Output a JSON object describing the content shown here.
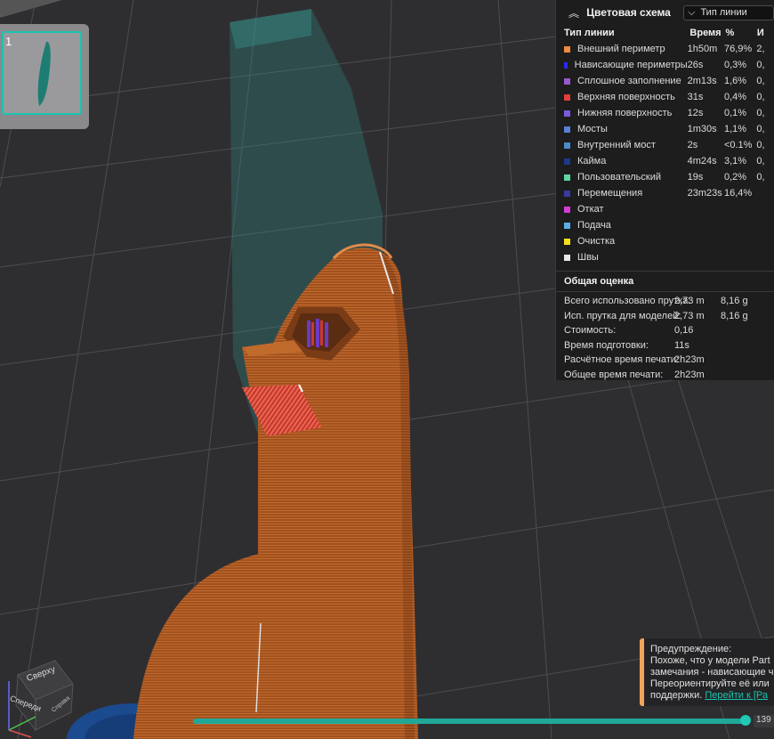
{
  "plate": {
    "number": "1",
    "arrow": ">"
  },
  "legend": {
    "collapse_icon": "double-chevron-up",
    "title": "Цветовая схема",
    "select_value": "Тип линии",
    "columns": [
      "Тип линии",
      "Время",
      "%",
      "И"
    ],
    "rows": [
      {
        "name": "Внешний периметр",
        "time": "1h50m",
        "pct": "76,9%",
        "extra": "2,",
        "color": "#f08a3c"
      },
      {
        "name": "Нависающие периметры",
        "time": "26s",
        "pct": "0,3%",
        "extra": "0,",
        "color": "#2a2aff"
      },
      {
        "name": "Сплошное заполнение",
        "time": "2m13s",
        "pct": "1,6%",
        "extra": "0,",
        "color": "#9b59d0"
      },
      {
        "name": "Верхняя поверхность",
        "time": "31s",
        "pct": "0,4%",
        "extra": "0,",
        "color": "#e0403a"
      },
      {
        "name": "Нижняя поверхность",
        "time": "12s",
        "pct": "0,1%",
        "extra": "0,",
        "color": "#7a5be0"
      },
      {
        "name": "Мосты",
        "time": "1m30s",
        "pct": "1,1%",
        "extra": "0,",
        "color": "#5a7fd6"
      },
      {
        "name": "Внутренний мост",
        "time": "2s",
        "pct": "<0.1%",
        "extra": "0,",
        "color": "#4a8cc8"
      },
      {
        "name": "Кайма",
        "time": "4m24s",
        "pct": "3,1%",
        "extra": "0,",
        "color": "#1a3a8a"
      },
      {
        "name": "Пользовательский",
        "time": "19s",
        "pct": "0,2%",
        "extra": "0,",
        "color": "#5ed6a0"
      },
      {
        "name": "Перемещения",
        "time": "23m23s",
        "pct": "16,4%",
        "extra": "",
        "color": "#3a3aa0"
      },
      {
        "name": "Откат",
        "time": "",
        "pct": "",
        "extra": "",
        "color": "#d63ad6"
      },
      {
        "name": "Подача",
        "time": "",
        "pct": "",
        "extra": "",
        "color": "#5aaee8"
      },
      {
        "name": "Очистка",
        "time": "",
        "pct": "",
        "extra": "",
        "color": "#f5e11a"
      },
      {
        "name": "Швы",
        "time": "",
        "pct": "",
        "extra": "",
        "color": "#e8e8e8"
      }
    ],
    "summary_title": "Общая оценка",
    "summary": [
      {
        "k": "Всего использовано прутка:",
        "v": "2,73 m",
        "w": "8,16 g"
      },
      {
        "k": "Исп. прутка для моделей:",
        "v": "2,73 m",
        "w": "8,16 g"
      },
      {
        "k": "Стоимость:",
        "v": "0,16",
        "w": ""
      },
      {
        "k": "Время подготовки:",
        "v": "11s",
        "w": ""
      },
      {
        "k": "Расчётное время печати:",
        "v": "2h23m",
        "w": ""
      },
      {
        "k": "Общее время печати:",
        "v": "2h23m",
        "w": ""
      }
    ]
  },
  "warning": {
    "title": "Предупреждение:",
    "line1": "Похоже, что у модели Part",
    "line2": "замечания - нависающие ч",
    "line3": "Переориентируйте её или",
    "line4_prefix": "поддержки.",
    "link": "Перейти к [Ра"
  },
  "slider": {
    "value": "139",
    "fill": 0.99
  },
  "gizmo": {
    "top_label": "Сверху",
    "front_label": "Спереди",
    "right_label": "Справа"
  }
}
